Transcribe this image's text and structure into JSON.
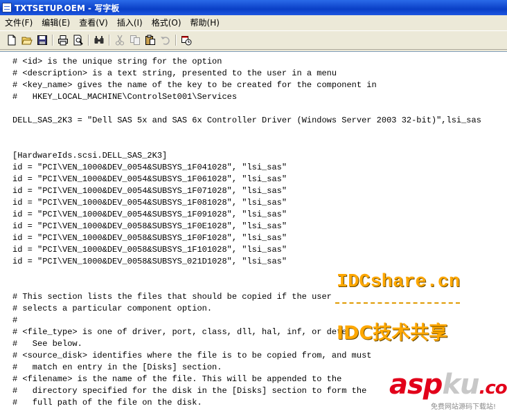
{
  "window": {
    "title": "TXTSETUP.OEM - 写字板"
  },
  "menu": [
    {
      "name": "menu-file",
      "label": "文件(F)"
    },
    {
      "name": "menu-edit",
      "label": "编辑(E)"
    },
    {
      "name": "menu-view",
      "label": "查看(V)"
    },
    {
      "name": "menu-insert",
      "label": "插入(I)"
    },
    {
      "name": "menu-format",
      "label": "格式(O)"
    },
    {
      "name": "menu-help",
      "label": "帮助(H)"
    }
  ],
  "toolbar": [
    "new-icon",
    "open-icon",
    "save-icon",
    "print-icon",
    "print-preview-icon",
    "find-icon",
    "cut-icon",
    "copy-icon",
    "paste-icon",
    "undo-icon",
    "date-time-icon"
  ],
  "document": {
    "lines": [
      "# <id> is the unique string for the option",
      "# <description> is a text string, presented to the user in a menu",
      "# <key_name> gives the name of the key to be created for the component in",
      "#   HKEY_LOCAL_MACHINE\\ControlSet001\\Services",
      "",
      "DELL_SAS_2K3 = \"Dell SAS 5x and SAS 6x Controller Driver (Windows Server 2003 32-bit)\",lsi_sas",
      "",
      "",
      "[HardwareIds.scsi.DELL_SAS_2K3]",
      "id = \"PCI\\VEN_1000&DEV_0054&SUBSYS_1F041028\", \"lsi_sas\"",
      "id = \"PCI\\VEN_1000&DEV_0054&SUBSYS_1F061028\", \"lsi_sas\"",
      "id = \"PCI\\VEN_1000&DEV_0054&SUBSYS_1F071028\", \"lsi_sas\"",
      "id = \"PCI\\VEN_1000&DEV_0054&SUBSYS_1F081028\", \"lsi_sas\"",
      "id = \"PCI\\VEN_1000&DEV_0054&SUBSYS_1F091028\", \"lsi_sas\"",
      "id = \"PCI\\VEN_1000&DEV_0058&SUBSYS_1F0E1028\", \"lsi_sas\"",
      "id = \"PCI\\VEN_1000&DEV_0058&SUBSYS_1F0F1028\", \"lsi_sas\"",
      "id = \"PCI\\VEN_1000&DEV_0058&SUBSYS_1F101028\", \"lsi_sas\"",
      "id = \"PCI\\VEN_1000&DEV_0058&SUBSYS_021D1028\", \"lsi_sas\"",
      "",
      "",
      "# This section lists the files that should be copied if the user",
      "# selects a particular component option.",
      "#",
      "# <file_type> is one of driver, port, class, dll, hal, inf, or dete",
      "#   See below.",
      "# <source_disk> identifies where the file is to be copied from, and must",
      "#   match en entry in the [Disks] section.",
      "# <filename> is the name of the file. This will be appended to the",
      "#   directory specified for the disk in the [Disks] section to form the",
      "#   full path of the file on the disk."
    ]
  },
  "watermark": {
    "site": "IDCshare.cn",
    "title": "IDC技术共享",
    "brand_a": "asp",
    "brand_b": "ku",
    "brand_c": ".com",
    "tagline": "免费网站源码下载站!"
  }
}
